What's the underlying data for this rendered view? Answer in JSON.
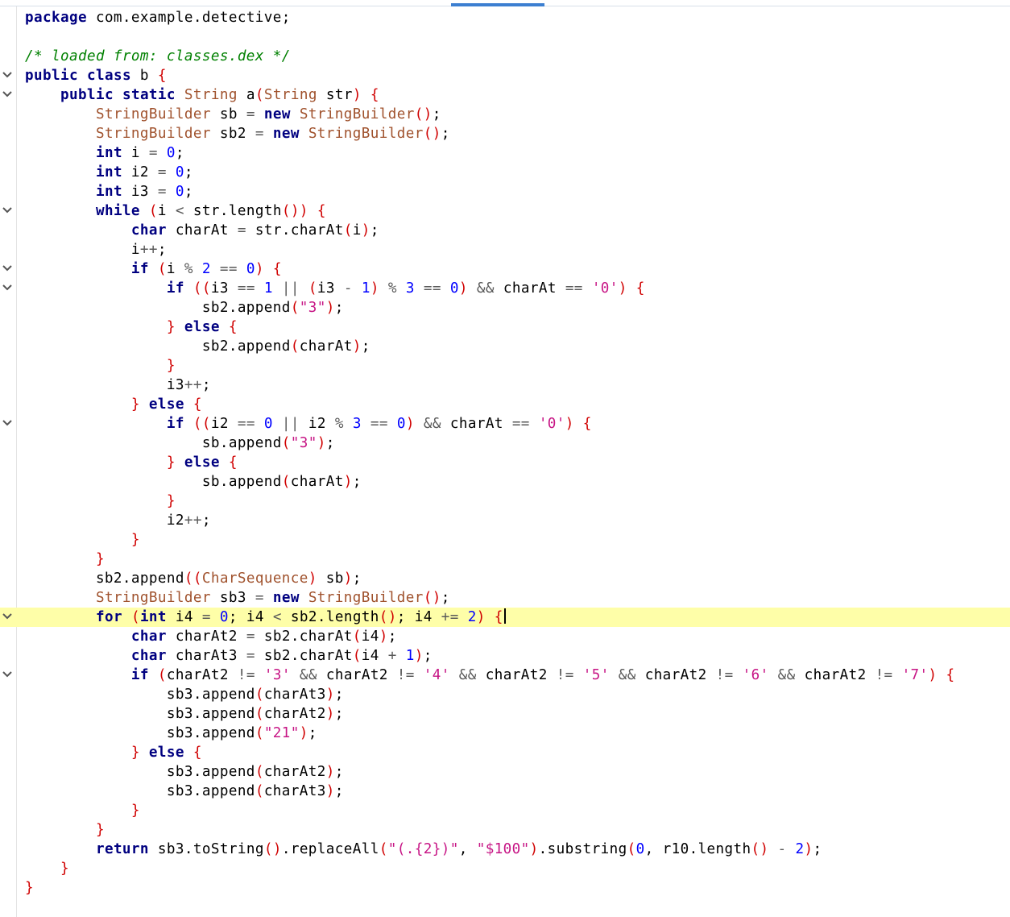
{
  "editor": {
    "language": "java",
    "current_line_index": 31,
    "fold_icon": "chevron-down-icon",
    "colors": {
      "keyword": "#000080",
      "type": "#a0522d",
      "number": "#0000ff",
      "string": "#c71585",
      "operator": "#5a5a5a",
      "bracket": "#d00000",
      "comment": "#008000",
      "current_line_bg": "#fefea8",
      "scroll_thumb": "#3c7fd1"
    },
    "lines": [
      "package com.example.detective;",
      "",
      "/* loaded from: classes.dex */",
      "public class b {",
      "    public static String a(String str) {",
      "        StringBuilder sb = new StringBuilder();",
      "        StringBuilder sb2 = new StringBuilder();",
      "        int i = 0;",
      "        int i2 = 0;",
      "        int i3 = 0;",
      "        while (i < str.length()) {",
      "            char charAt = str.charAt(i);",
      "            i++;",
      "            if (i % 2 == 0) {",
      "                if ((i3 == 1 || (i3 - 1) % 3 == 0) && charAt == '0') {",
      "                    sb2.append(\"3\");",
      "                } else {",
      "                    sb2.append(charAt);",
      "                }",
      "                i3++;",
      "            } else {",
      "                if ((i2 == 0 || i2 % 3 == 0) && charAt == '0') {",
      "                    sb.append(\"3\");",
      "                } else {",
      "                    sb.append(charAt);",
      "                }",
      "                i2++;",
      "            }",
      "        }",
      "        sb2.append((CharSequence) sb);",
      "        StringBuilder sb3 = new StringBuilder();",
      "        for (int i4 = 0; i4 < sb2.length(); i4 += 2) {",
      "            char charAt2 = sb2.charAt(i4);",
      "            char charAt3 = sb2.charAt(i4 + 1);",
      "            if (charAt2 != '3' && charAt2 != '4' && charAt2 != '5' && charAt2 != '6' && charAt2 != '7') {",
      "                sb3.append(charAt3);",
      "                sb3.append(charAt2);",
      "                sb3.append(\"21\");",
      "            } else {",
      "                sb3.append(charAt2);",
      "                sb3.append(charAt3);",
      "            }",
      "        }",
      "        return sb3.toString().replaceAll(\"(.{2})\", \"$100\").substring(0, r10.length() - 2);",
      "    }",
      "}"
    ],
    "foldable_lines": [
      3,
      4,
      10,
      13,
      14,
      21,
      31,
      34
    ]
  }
}
